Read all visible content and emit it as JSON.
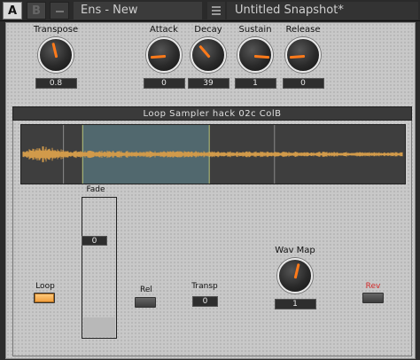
{
  "header": {
    "a_label": "A",
    "b_label": "B",
    "preset_name": "Ens - New",
    "snapshot_name": "Untitled Snapshot*"
  },
  "envelope": {
    "transpose": {
      "label": "Transpose",
      "value": "0.8",
      "knob_level": 0.45
    },
    "attack": {
      "label": "Attack",
      "value": "0",
      "knob_level": 0.15
    },
    "decay": {
      "label": "Decay",
      "value": "39",
      "knob_level": 0.35
    },
    "sustain": {
      "label": "Sustain",
      "value": "1",
      "knob_level": 0.85
    },
    "release": {
      "label": "Release",
      "value": "0",
      "knob_level": 0.15
    }
  },
  "sampler": {
    "title": "Loop Sampler hack 02c ColB",
    "loop_region": {
      "start": 0.16,
      "end": 0.49
    },
    "markers": [
      0.11,
      0.16,
      0.49,
      0.66
    ],
    "fade": {
      "label": "Fade",
      "value": "0",
      "level": 0.14
    },
    "loop": {
      "label": "Loop",
      "state": "on"
    },
    "rel": {
      "label": "Rel",
      "state": "off"
    },
    "transp": {
      "label": "Transp",
      "value": "0"
    },
    "wav_map": {
      "label": "Wav Map",
      "value": "1",
      "knob_level": 0.55
    },
    "rev": {
      "label": "Rev",
      "state": "off"
    }
  },
  "colors": {
    "accent": "#ff7a1a",
    "rev_label": "#d42b2b",
    "waveform": "#d19a4a",
    "loop_region": "#5c7f88"
  }
}
